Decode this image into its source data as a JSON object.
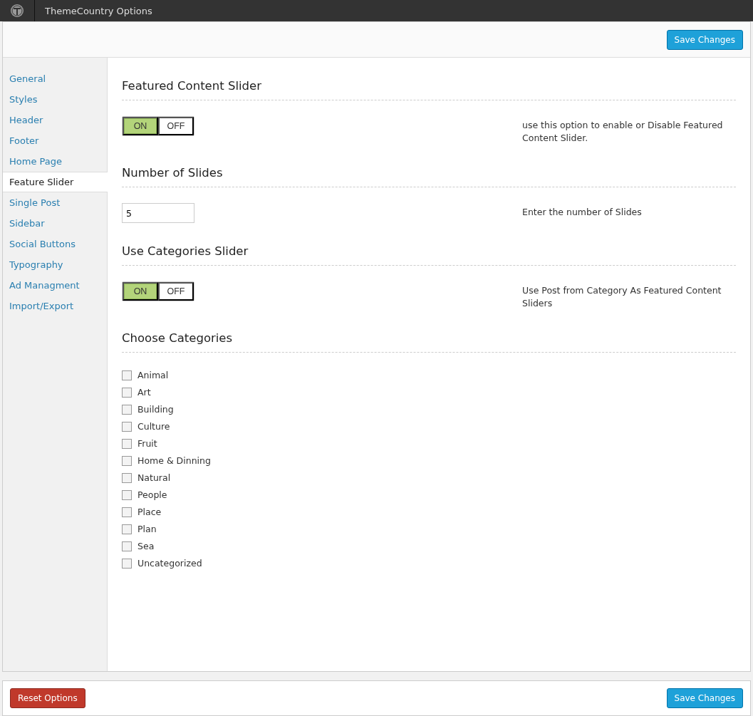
{
  "topbar": {
    "title": "ThemeCountry Options"
  },
  "header": {
    "save_button": "Save Changes"
  },
  "sidebar": {
    "items": [
      {
        "label": "General",
        "selected": false
      },
      {
        "label": "Styles",
        "selected": false
      },
      {
        "label": "Header",
        "selected": false
      },
      {
        "label": "Footer",
        "selected": false
      },
      {
        "label": "Home Page",
        "selected": false
      },
      {
        "label": "Feature Slider",
        "selected": true
      },
      {
        "label": "Single Post",
        "selected": false
      },
      {
        "label": "Sidebar",
        "selected": false
      },
      {
        "label": "Social Buttons",
        "selected": false
      },
      {
        "label": "Typography",
        "selected": false
      },
      {
        "label": "Ad Managment",
        "selected": false
      },
      {
        "label": "Import/Export",
        "selected": false
      }
    ]
  },
  "sections": [
    {
      "kind": "toggle",
      "title": "Featured Content Slider",
      "on_label": "ON",
      "off_label": "OFF",
      "on": true,
      "description": "use this option to enable or Disable Featured Content Slider."
    },
    {
      "kind": "number",
      "title": "Number of Slides",
      "value": "5",
      "description": "Enter the number of Slides"
    },
    {
      "kind": "toggle",
      "title": "Use Categories Slider",
      "on_label": "ON",
      "off_label": "OFF",
      "on": true,
      "description": "Use Post from Category As Featured Content Sliders"
    },
    {
      "kind": "checkboxes",
      "title": "Choose Categories",
      "options": [
        {
          "label": "Animal",
          "checked": false
        },
        {
          "label": "Art",
          "checked": false
        },
        {
          "label": "Building",
          "checked": false
        },
        {
          "label": "Culture",
          "checked": false
        },
        {
          "label": "Fruit",
          "checked": false
        },
        {
          "label": "Home & Dinning",
          "checked": false
        },
        {
          "label": "Natural",
          "checked": false
        },
        {
          "label": "People",
          "checked": false
        },
        {
          "label": "Place",
          "checked": false
        },
        {
          "label": "Plan",
          "checked": false
        },
        {
          "label": "Sea",
          "checked": false
        },
        {
          "label": "Uncategorized",
          "checked": false
        }
      ]
    }
  ],
  "footer": {
    "reset_button": "Reset Options",
    "save_button": "Save Changes"
  }
}
